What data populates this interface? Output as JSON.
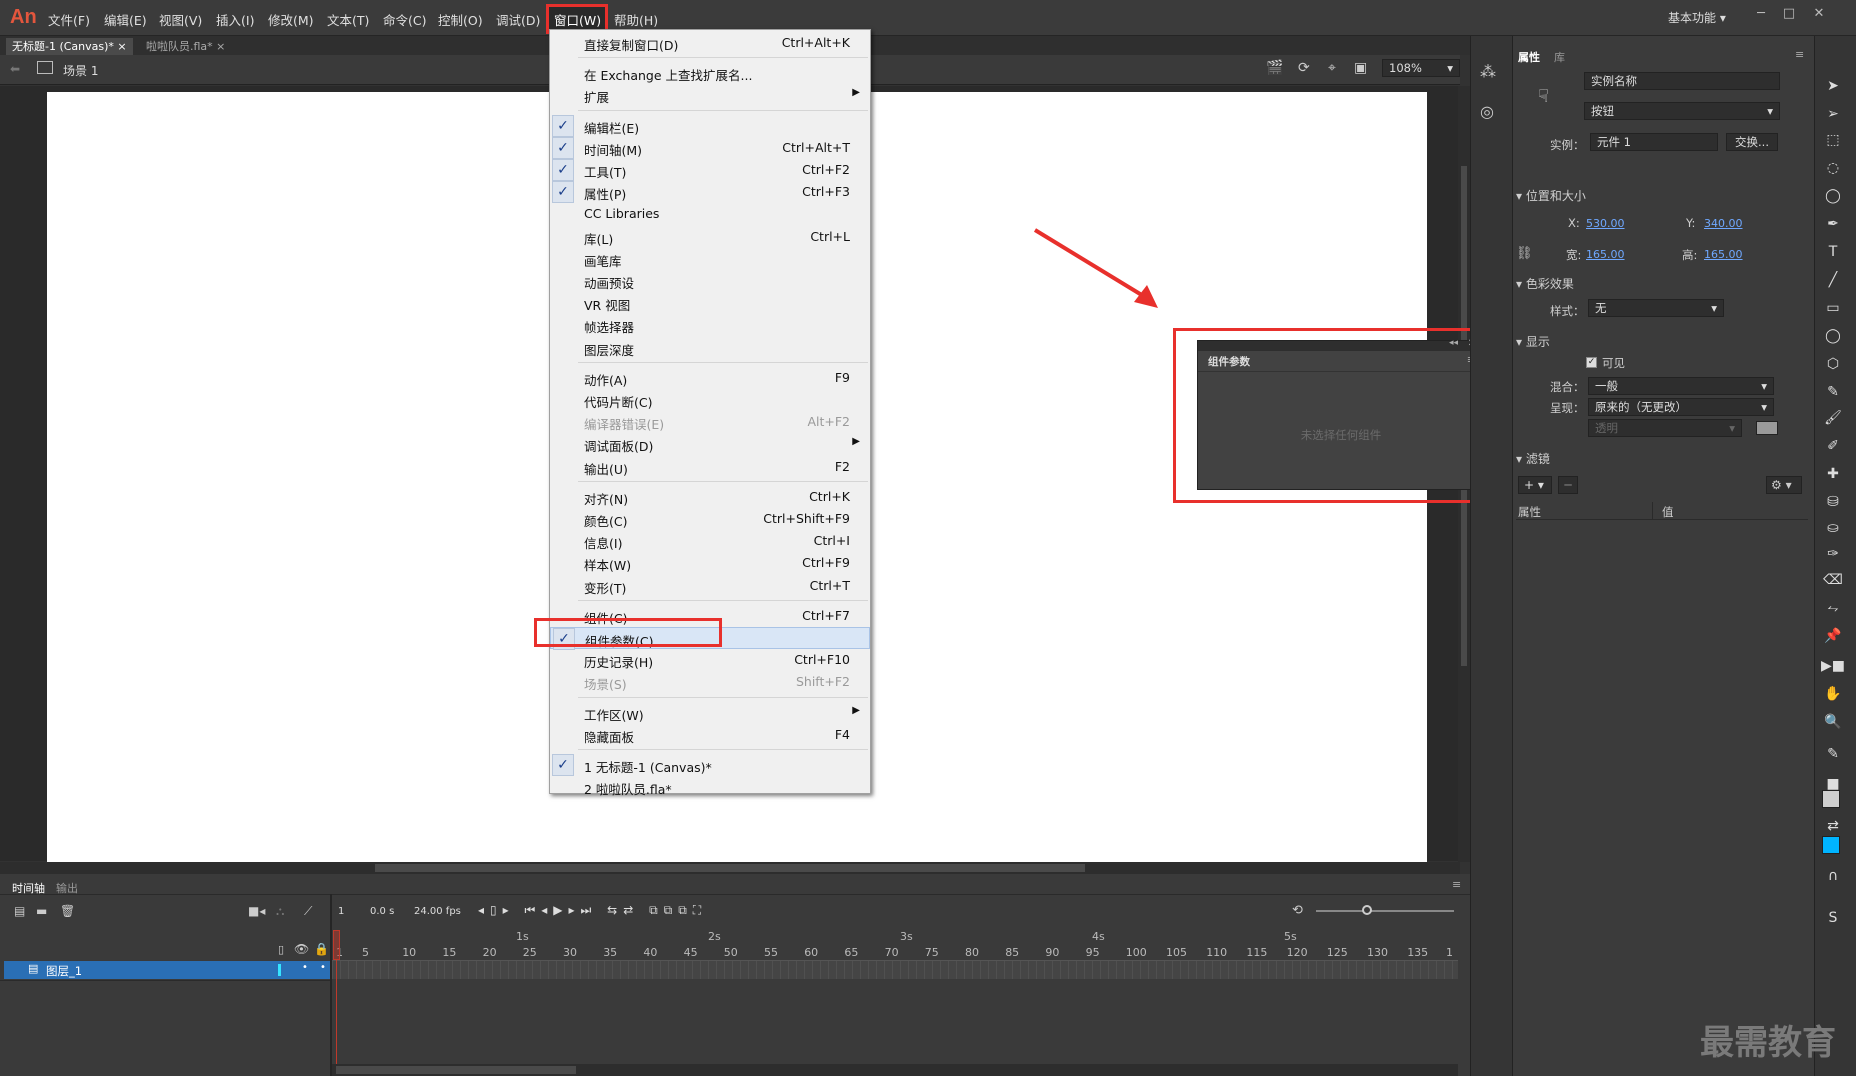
{
  "app": {
    "logo": "An",
    "workspace": "基本功能"
  },
  "menubar": [
    "文件(F)",
    "编辑(E)",
    "视图(V)",
    "插入(I)",
    "修改(M)",
    "文本(T)",
    "命令(C)",
    "控制(O)",
    "调试(D)",
    "窗口(W)",
    "帮助(H)"
  ],
  "doc_tabs": [
    "无标题-1 (Canvas)*",
    "啦啦队员.fla*"
  ],
  "scene": {
    "label": "场景 1",
    "zoom": "108%"
  },
  "window_menu": [
    {
      "label": "直接复制窗口(D)",
      "shortcut": "Ctrl+Alt+K"
    },
    {
      "sep": true
    },
    {
      "label": "在 Exchange 上查找扩展名..."
    },
    {
      "label": "扩展",
      "submenu": true
    },
    {
      "sep": true
    },
    {
      "label": "编辑栏(E)",
      "checked": true
    },
    {
      "label": "时间轴(M)",
      "shortcut": "Ctrl+Alt+T",
      "checked": true
    },
    {
      "label": "工具(T)",
      "shortcut": "Ctrl+F2",
      "checked": true
    },
    {
      "label": "属性(P)",
      "shortcut": "Ctrl+F3",
      "checked": true
    },
    {
      "label": "CC Libraries"
    },
    {
      "label": "库(L)",
      "shortcut": "Ctrl+L"
    },
    {
      "label": "画笔库"
    },
    {
      "label": "动画预设"
    },
    {
      "label": "VR 视图"
    },
    {
      "label": "帧选择器"
    },
    {
      "label": "图层深度"
    },
    {
      "sep": true
    },
    {
      "label": "动作(A)",
      "shortcut": "F9"
    },
    {
      "label": "代码片断(C)"
    },
    {
      "label": "编译器错误(E)",
      "shortcut": "Alt+F2",
      "disabled": true
    },
    {
      "label": "调试面板(D)",
      "submenu": true
    },
    {
      "label": "输出(U)",
      "shortcut": "F2"
    },
    {
      "sep": true
    },
    {
      "label": "对齐(N)",
      "shortcut": "Ctrl+K"
    },
    {
      "label": "颜色(C)",
      "shortcut": "Ctrl+Shift+F9"
    },
    {
      "label": "信息(I)",
      "shortcut": "Ctrl+I"
    },
    {
      "label": "样本(W)",
      "shortcut": "Ctrl+F9"
    },
    {
      "label": "变形(T)",
      "shortcut": "Ctrl+T"
    },
    {
      "sep": true
    },
    {
      "label": "组件(C)",
      "shortcut": "Ctrl+F7"
    },
    {
      "label": "组件参数(C)",
      "checked": true,
      "hover": true
    },
    {
      "label": "历史记录(H)",
      "shortcut": "Ctrl+F10"
    },
    {
      "label": "场景(S)",
      "shortcut": "Shift+F2",
      "disabled": true
    },
    {
      "sep": true
    },
    {
      "label": "工作区(W)",
      "submenu": true
    },
    {
      "label": "隐藏面板",
      "shortcut": "F4"
    },
    {
      "sep": true
    },
    {
      "label": "1 无标题-1 (Canvas)*",
      "checked": true
    },
    {
      "label": "2 啦啦队员.fla*"
    }
  ],
  "component_panel": {
    "title": "组件参数",
    "empty_text": "未选择任何组件"
  },
  "properties": {
    "tabs": [
      "属性",
      "库"
    ],
    "instance_name_placeholder": "实例名称",
    "type": "按钮",
    "instance_label": "实例：",
    "instance_value": "元件 1",
    "swap_button": "交换...",
    "pos_size_header": "位置和大小",
    "x_label": "X:",
    "x": "530.00",
    "y_label": "Y:",
    "y": "340.00",
    "w_label": "宽:",
    "w": "165.00",
    "h_label": "高:",
    "h": "165.00",
    "color_effect_header": "色彩效果",
    "style_label": "样式：",
    "style_value": "无",
    "display_header": "显示",
    "visible_label": "可见",
    "blend_label": "混合：",
    "blend_value": "一般",
    "render_label": "呈现：",
    "render_value": "原来的（无更改）",
    "transparent": "透明",
    "filters_header": "滤镜",
    "col_prop": "属性",
    "col_value": "值"
  },
  "timeline": {
    "tabs": [
      "时间轴",
      "输出"
    ],
    "frame": "1",
    "time": "0.0 s",
    "fps": "24.00 fps",
    "layer": "图层_1",
    "seconds": [
      "1s",
      "2s",
      "3s",
      "4s",
      "5s"
    ],
    "frames": [
      "1",
      "5",
      "10",
      "15",
      "20",
      "25",
      "30",
      "35",
      "40",
      "45",
      "50",
      "55",
      "60",
      "65",
      "70",
      "75",
      "80",
      "85",
      "90",
      "95",
      "100",
      "105",
      "110",
      "115",
      "120",
      "125",
      "130",
      "135",
      "1"
    ]
  },
  "watermark": "最需教育",
  "colors": {
    "highlight": "#e8302c",
    "accent_blue": "#2a6fb5",
    "stage": "#ffffff",
    "playhead": "#c0392b"
  }
}
